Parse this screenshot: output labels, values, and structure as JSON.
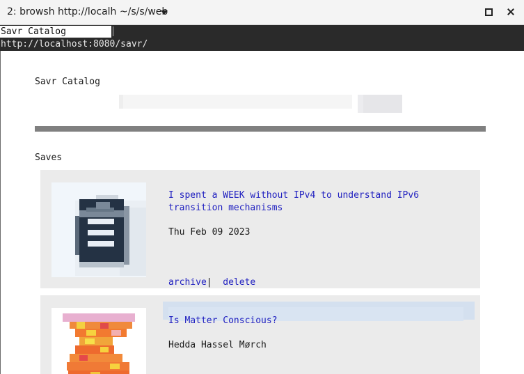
{
  "window": {
    "title": "2: browsh http://localh ~/s/s/web",
    "title_menu_icon": "chevron-down-icon",
    "maximize_icon": "maximize-icon",
    "close_icon": "close-icon"
  },
  "browser": {
    "tab_label": "Savr Catalog",
    "url": "http://localhost:8080/savr/"
  },
  "page": {
    "site_title": "Savr Catalog",
    "search": {
      "value": "",
      "placeholder": ""
    },
    "section_heading": "Saves",
    "items": [
      {
        "title": "I spent a WEEK without IPv4 to understand IPv6\ntransition mechanisms",
        "date": "Thu Feb 09 2023",
        "thumbnail_icon": "document-icon",
        "actions": {
          "archive": "archive",
          "separator": "|",
          "delete": "delete"
        }
      },
      {
        "title": "Is Matter Conscious?",
        "author": "Hedda Hassel Mørch",
        "thumbnail_icon": "abstract-art-icon"
      }
    ]
  },
  "colors": {
    "link": "#2020c0",
    "card_bg": "#ebebeb",
    "divider": "#808080",
    "header_bg": "#2a2a2a"
  }
}
